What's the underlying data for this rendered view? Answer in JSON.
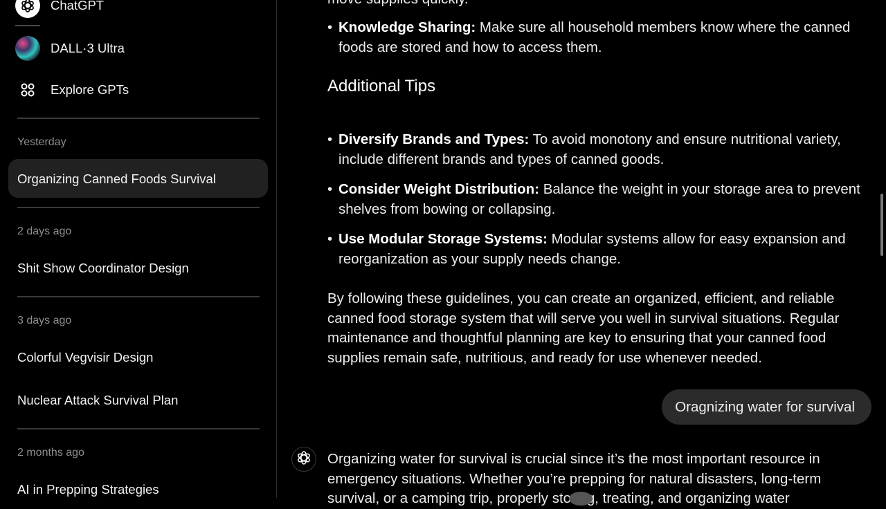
{
  "sidebar": {
    "top_items": [
      {
        "label": "ChatGPT",
        "icon": "openai-logo-icon"
      },
      {
        "label": "DALL·3 Ultra",
        "icon": "dalle-avatar-icon"
      },
      {
        "label": "Explore GPTs",
        "icon": "grid-dots-icon"
      }
    ],
    "groups": [
      {
        "label": "Yesterday",
        "items": [
          "Organizing Canned Foods Survival"
        ]
      },
      {
        "label": "2 days ago",
        "items": [
          "Shit Show Coordinator Design"
        ]
      },
      {
        "label": "3 days ago",
        "items": [
          "Colorful Vegvisir Design",
          "Nuclear Attack Survival Plan"
        ]
      },
      {
        "label": "2 months ago",
        "items": [
          "AI in Prepping Strategies"
        ]
      }
    ],
    "active_item": "Organizing Canned Foods Survival"
  },
  "chat": {
    "partial_top_line": "move supplies quickly.",
    "knowledge_bullet": {
      "title": "Knowledge Sharing:",
      "text": " Make sure all household members know where the canned foods are stored and how to access them."
    },
    "section_heading": "Additional Tips",
    "tips": [
      {
        "title": "Diversify Brands and Types:",
        "text": " To avoid monotony and ensure nutritional variety, include different brands and types of canned goods."
      },
      {
        "title": "Consider Weight Distribution:",
        "text": " Balance the weight in your storage area to prevent shelves from bowing or collapsing."
      },
      {
        "title": "Use Modular Storage Systems:",
        "text": " Modular systems allow for easy expansion and reorganization as your supply needs change."
      }
    ],
    "conclusion": "By following these guidelines, you can create an organized, efficient, and reliable canned food storage system that will serve you well in survival situations. Regular maintenance and thoughtful planning are key to ensuring that your canned food supplies remain safe, nutritious, and ready for use whenever needed.",
    "user_message": "Oragnizing water for survival",
    "assistant_reply": "Organizing water for survival is crucial since it’s the most important resource in emergency situations. Whether you’re prepping for natural disasters, long-term survival, or a camping trip, properly storing, treating, and organizing water"
  },
  "bullet_char": "•"
}
